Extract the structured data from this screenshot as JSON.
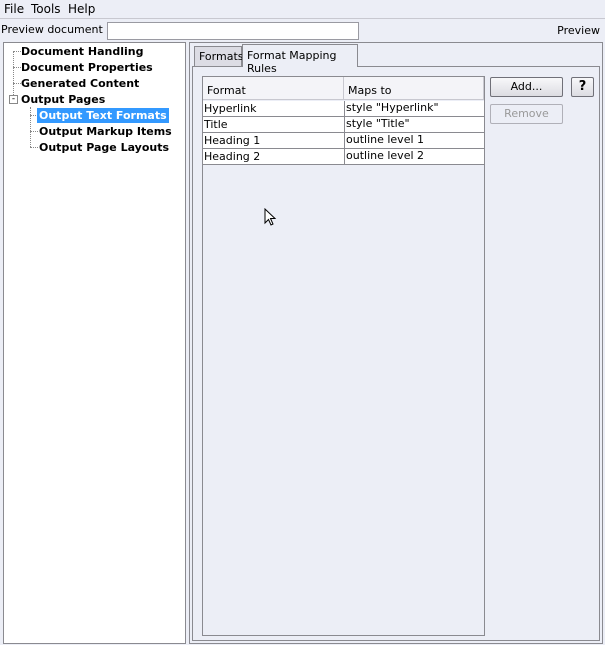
{
  "menu": [
    "File",
    "Tools",
    "Help"
  ],
  "preview_id": {
    "label": "Preview document ID:",
    "value": ""
  },
  "preview_label": "Preview",
  "tree": [
    {
      "label": "Document Handling"
    },
    {
      "label": "Document Properties"
    },
    {
      "label": "Generated Content"
    },
    {
      "label": "Output Pages",
      "expanded": true
    },
    {
      "label": "Output Text Formats",
      "selected": true
    },
    {
      "label": "Output Markup Items"
    },
    {
      "label": "Output Page Layouts"
    }
  ],
  "tabs": [
    "Formats",
    "Format Mapping Rules"
  ],
  "active_tab": "Format Mapping Rules",
  "table": {
    "columns": [
      "Format",
      "Maps to"
    ],
    "rows": [
      [
        "Hyperlink",
        "style \"Hyperlink\""
      ],
      [
        "Title",
        "style \"Title\""
      ],
      [
        "Heading 1",
        "outline level 1"
      ],
      [
        "Heading 2",
        "outline level 2"
      ]
    ]
  },
  "buttons": {
    "add": "Add...",
    "remove": "Remove",
    "help": "?"
  }
}
